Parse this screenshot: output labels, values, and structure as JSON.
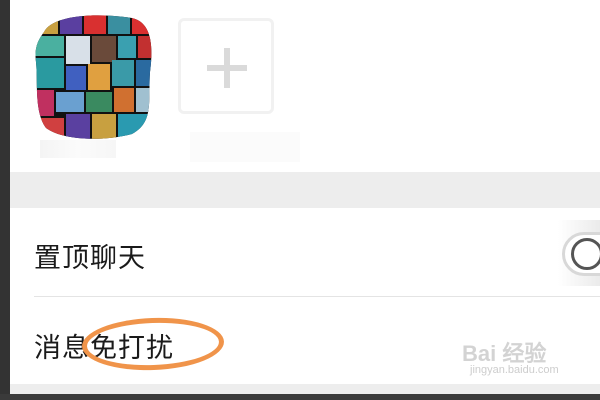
{
  "members": {
    "add_icon": "plus-icon"
  },
  "settings": {
    "pin_chat": {
      "label": "置顶聊天",
      "enabled": false
    },
    "mute_notifications": {
      "label": "消息免打扰"
    }
  },
  "annotation": {
    "color": "#f0944a"
  },
  "watermark": {
    "brand": "Bai 经验",
    "url": "jingyan.baidu.com"
  }
}
